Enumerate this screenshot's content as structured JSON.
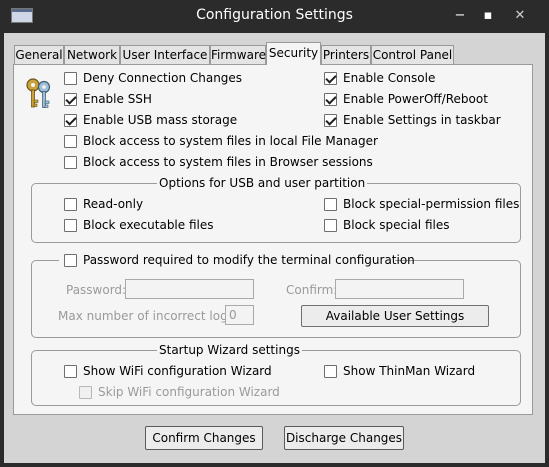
{
  "window": {
    "title": "Configuration Settings",
    "controls": {
      "minimize": "−",
      "maximize": "▪",
      "close": "✕"
    }
  },
  "tabs": [
    {
      "label": "General"
    },
    {
      "label": "Network"
    },
    {
      "label": "User Interface"
    },
    {
      "label": "Firmware"
    },
    {
      "label": "Security",
      "active": true
    },
    {
      "label": "Printers"
    },
    {
      "label": "Control Panel"
    }
  ],
  "security": {
    "icon": "keys-icon",
    "options": [
      {
        "label": "Deny Connection Changes",
        "checked": false
      },
      {
        "label": "Enable SSH",
        "checked": true
      },
      {
        "label": "Enable USB mass storage",
        "checked": true
      },
      {
        "label": "Block access to system files in local File Manager",
        "checked": false
      },
      {
        "label": "Block access to system files in Browser sessions",
        "checked": false
      },
      {
        "label": "Enable Console",
        "checked": true
      },
      {
        "label": "Enable PowerOff/Reboot",
        "checked": true
      },
      {
        "label": "Enable Settings in taskbar",
        "checked": true
      }
    ]
  },
  "usb_group": {
    "title": "Options for USB and user partition",
    "options": [
      {
        "label": "Read-only",
        "checked": false
      },
      {
        "label": "Block executable files",
        "checked": false
      },
      {
        "label": "Block special-permission files",
        "checked": false
      },
      {
        "label": "Block special files",
        "checked": false
      }
    ]
  },
  "password_group": {
    "title": "Password required to modify the terminal configuration",
    "checked": false,
    "password_label": "Password:",
    "password_value": "",
    "confirm_label": "Confirm:",
    "confirm_value": "",
    "max_login_label": "Max number of incorrect login:",
    "max_login_value": "0",
    "available_button": "Available User Settings"
  },
  "wizard_group": {
    "title": "Startup Wizard settings",
    "options": [
      {
        "label": "Show WiFi configuration Wizard",
        "checked": false
      },
      {
        "label": "Skip WiFi configuration Wizard",
        "checked": false,
        "disabled": true
      },
      {
        "label": "Show ThinMan Wizard",
        "checked": false
      }
    ]
  },
  "footer": {
    "confirm_button": "Confirm Changes",
    "discharge_button": "Discharge Changes"
  }
}
